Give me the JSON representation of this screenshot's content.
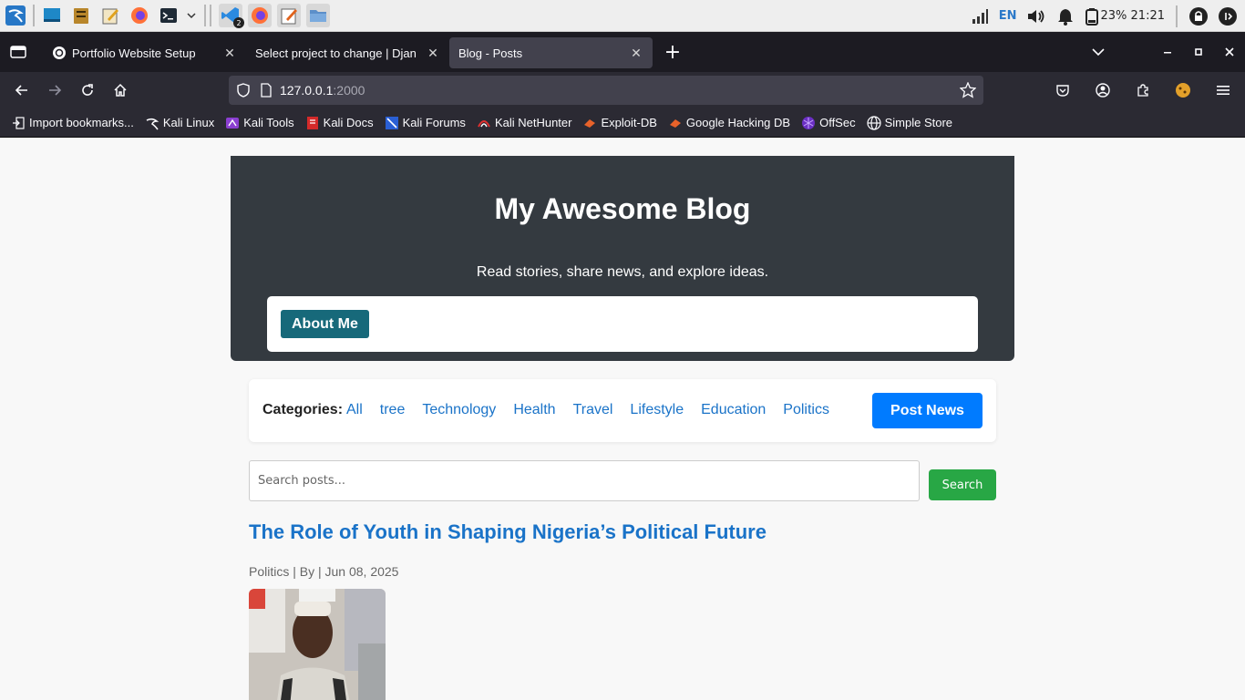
{
  "taskbar": {
    "apps": [
      {
        "icon": "kali-menu-icon"
      },
      {
        "icon": "desktop-icon"
      },
      {
        "icon": "file-manager-icon"
      },
      {
        "icon": "text-editor-icon"
      },
      {
        "icon": "firefox-icon"
      },
      {
        "icon": "terminal-icon"
      }
    ],
    "running_badge": "2",
    "lang": "EN",
    "battery_time": "23% 21:21"
  },
  "browser": {
    "tabs": [
      {
        "label": "Portfolio Website Setup",
        "selected": false
      },
      {
        "label": "Select project to change | Djan",
        "selected": false
      },
      {
        "label": "Blog - Posts",
        "selected": true
      }
    ],
    "url_host": "127.0.0.1",
    "url_port": ":2000"
  },
  "bookmarks": [
    {
      "label": "Import bookmarks...",
      "icon": "import-icon"
    },
    {
      "label": "Kali Linux",
      "icon": "kali-linux-icon"
    },
    {
      "label": "Kali Tools",
      "icon": "kali-tools-icon"
    },
    {
      "label": "Kali Docs",
      "icon": "kali-docs-icon"
    },
    {
      "label": "Kali Forums",
      "icon": "kali-forums-icon"
    },
    {
      "label": "Kali NetHunter",
      "icon": "kali-nethunter-icon"
    },
    {
      "label": "Exploit-DB",
      "icon": "exploit-db-icon"
    },
    {
      "label": "Google Hacking DB",
      "icon": "ghdb-icon"
    },
    {
      "label": "OffSec",
      "icon": "offsec-icon"
    },
    {
      "label": "Simple Store",
      "icon": "globe-icon"
    }
  ],
  "page": {
    "hero_title": "My Awesome Blog",
    "hero_subtitle": "Read stories, share news, and explore ideas.",
    "about_button": "About Me",
    "categories_label": "Categories:",
    "categories": [
      "All",
      "tree",
      "Technology",
      "Health",
      "Travel",
      "Lifestyle",
      "Education",
      "Politics"
    ],
    "post_news_button": "Post News",
    "search_placeholder": "Search posts...",
    "search_button": "Search",
    "post": {
      "title": "The Role of Youth in Shaping Nigeria’s Political Future",
      "meta": "Politics | By | Jun 08, 2025"
    }
  }
}
